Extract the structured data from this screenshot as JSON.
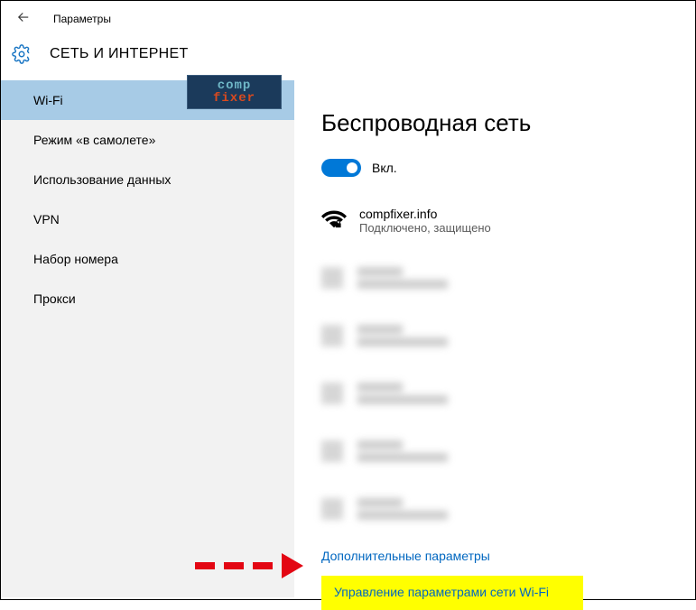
{
  "header": {
    "title": "Параметры"
  },
  "page": {
    "title": "СЕТЬ И ИНТЕРНЕТ"
  },
  "sidebar": {
    "items": [
      {
        "label": "Wi-Fi",
        "active": true
      },
      {
        "label": "Режим «в самолете»",
        "active": false
      },
      {
        "label": "Использование данных",
        "active": false
      },
      {
        "label": "VPN",
        "active": false
      },
      {
        "label": "Набор номера",
        "active": false
      },
      {
        "label": "Прокси",
        "active": false
      }
    ]
  },
  "watermark": {
    "top": "comp",
    "bottom": "fixer"
  },
  "main": {
    "title": "Беспроводная сеть",
    "toggle": {
      "label": "Вкл.",
      "on": true
    },
    "connected_network": {
      "name": "compfixer.info",
      "status": "Подключено, защищено"
    },
    "links": {
      "advanced": "Дополнительные параметры",
      "manage": "Управление параметрами сети Wi-Fi"
    }
  }
}
